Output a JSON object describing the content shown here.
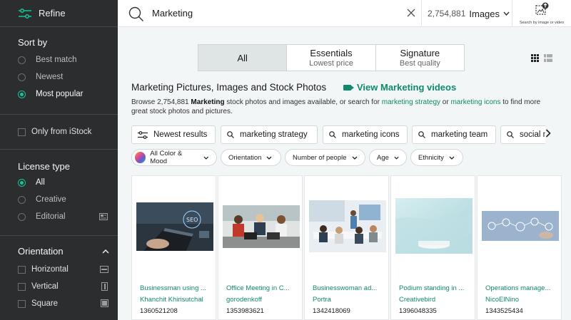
{
  "sidebar": {
    "refine_label": "Refine",
    "sort": {
      "title": "Sort by",
      "options": [
        {
          "label": "Best match",
          "selected": false
        },
        {
          "label": "Newest",
          "selected": false
        },
        {
          "label": "Most popular",
          "selected": true
        }
      ]
    },
    "only_istock": "Only from iStock",
    "license": {
      "title": "License type",
      "options": [
        {
          "label": "All",
          "selected": true
        },
        {
          "label": "Creative",
          "selected": false
        },
        {
          "label": "Editorial",
          "selected": false
        }
      ]
    },
    "orientation": {
      "title": "Orientation",
      "options": [
        "Horizontal",
        "Vertical",
        "Square"
      ]
    }
  },
  "topbar": {
    "query": "Marketing",
    "count": "2,754,881",
    "media_type": "Images",
    "image_search_label": "Search by image or video"
  },
  "tabs": [
    {
      "title": "All",
      "subtitle": "",
      "active": true
    },
    {
      "title": "Essentials",
      "subtitle": "Lowest price",
      "active": false
    },
    {
      "title": "Signature",
      "subtitle": "Best quality",
      "active": false
    }
  ],
  "heading": {
    "title": "Marketing Pictures, Images and Stock Photos",
    "videos_link": "View Marketing videos",
    "desc_prefix": "Browse 2,754,881 ",
    "desc_bold": "Marketing",
    "desc_mid": " stock photos and images available, or search for ",
    "desc_link1": "marketing strategy",
    "desc_or": " or ",
    "desc_link2": "marketing icons",
    "desc_suffix": " to find more great stock photos and pictures."
  },
  "related": [
    {
      "label": "Newest results",
      "icon": "sliders-icon"
    },
    {
      "label": "marketing strategy",
      "icon": "search-icon"
    },
    {
      "label": "marketing icons",
      "icon": "search-icon"
    },
    {
      "label": "marketing team",
      "icon": "search-icon"
    },
    {
      "label": "social m",
      "icon": "search-icon"
    }
  ],
  "filters": [
    {
      "label": "All Color & Mood"
    },
    {
      "label": "Orientation"
    },
    {
      "label": "Number of people"
    },
    {
      "label": "Age"
    },
    {
      "label": "Ethnicity"
    }
  ],
  "cards": [
    {
      "title": "Businessman using ...",
      "author": "Khanchit Khirisutchal",
      "id": "1360521208"
    },
    {
      "title": "Office Meeting in C...",
      "author": "gorodenkoff",
      "id": "1353983621"
    },
    {
      "title": "Businesswoman ad...",
      "author": "Portra",
      "id": "1342418069"
    },
    {
      "title": "Podium standing in ...",
      "author": "Creativebird",
      "id": "1396048335"
    },
    {
      "title": "Operations manage...",
      "author": "NicoElNino",
      "id": "1343525434"
    }
  ],
  "colors": {
    "accent": "#0f8a6c",
    "radio_on": "#19c39a",
    "sidebar_bg": "#2b2d2f"
  }
}
